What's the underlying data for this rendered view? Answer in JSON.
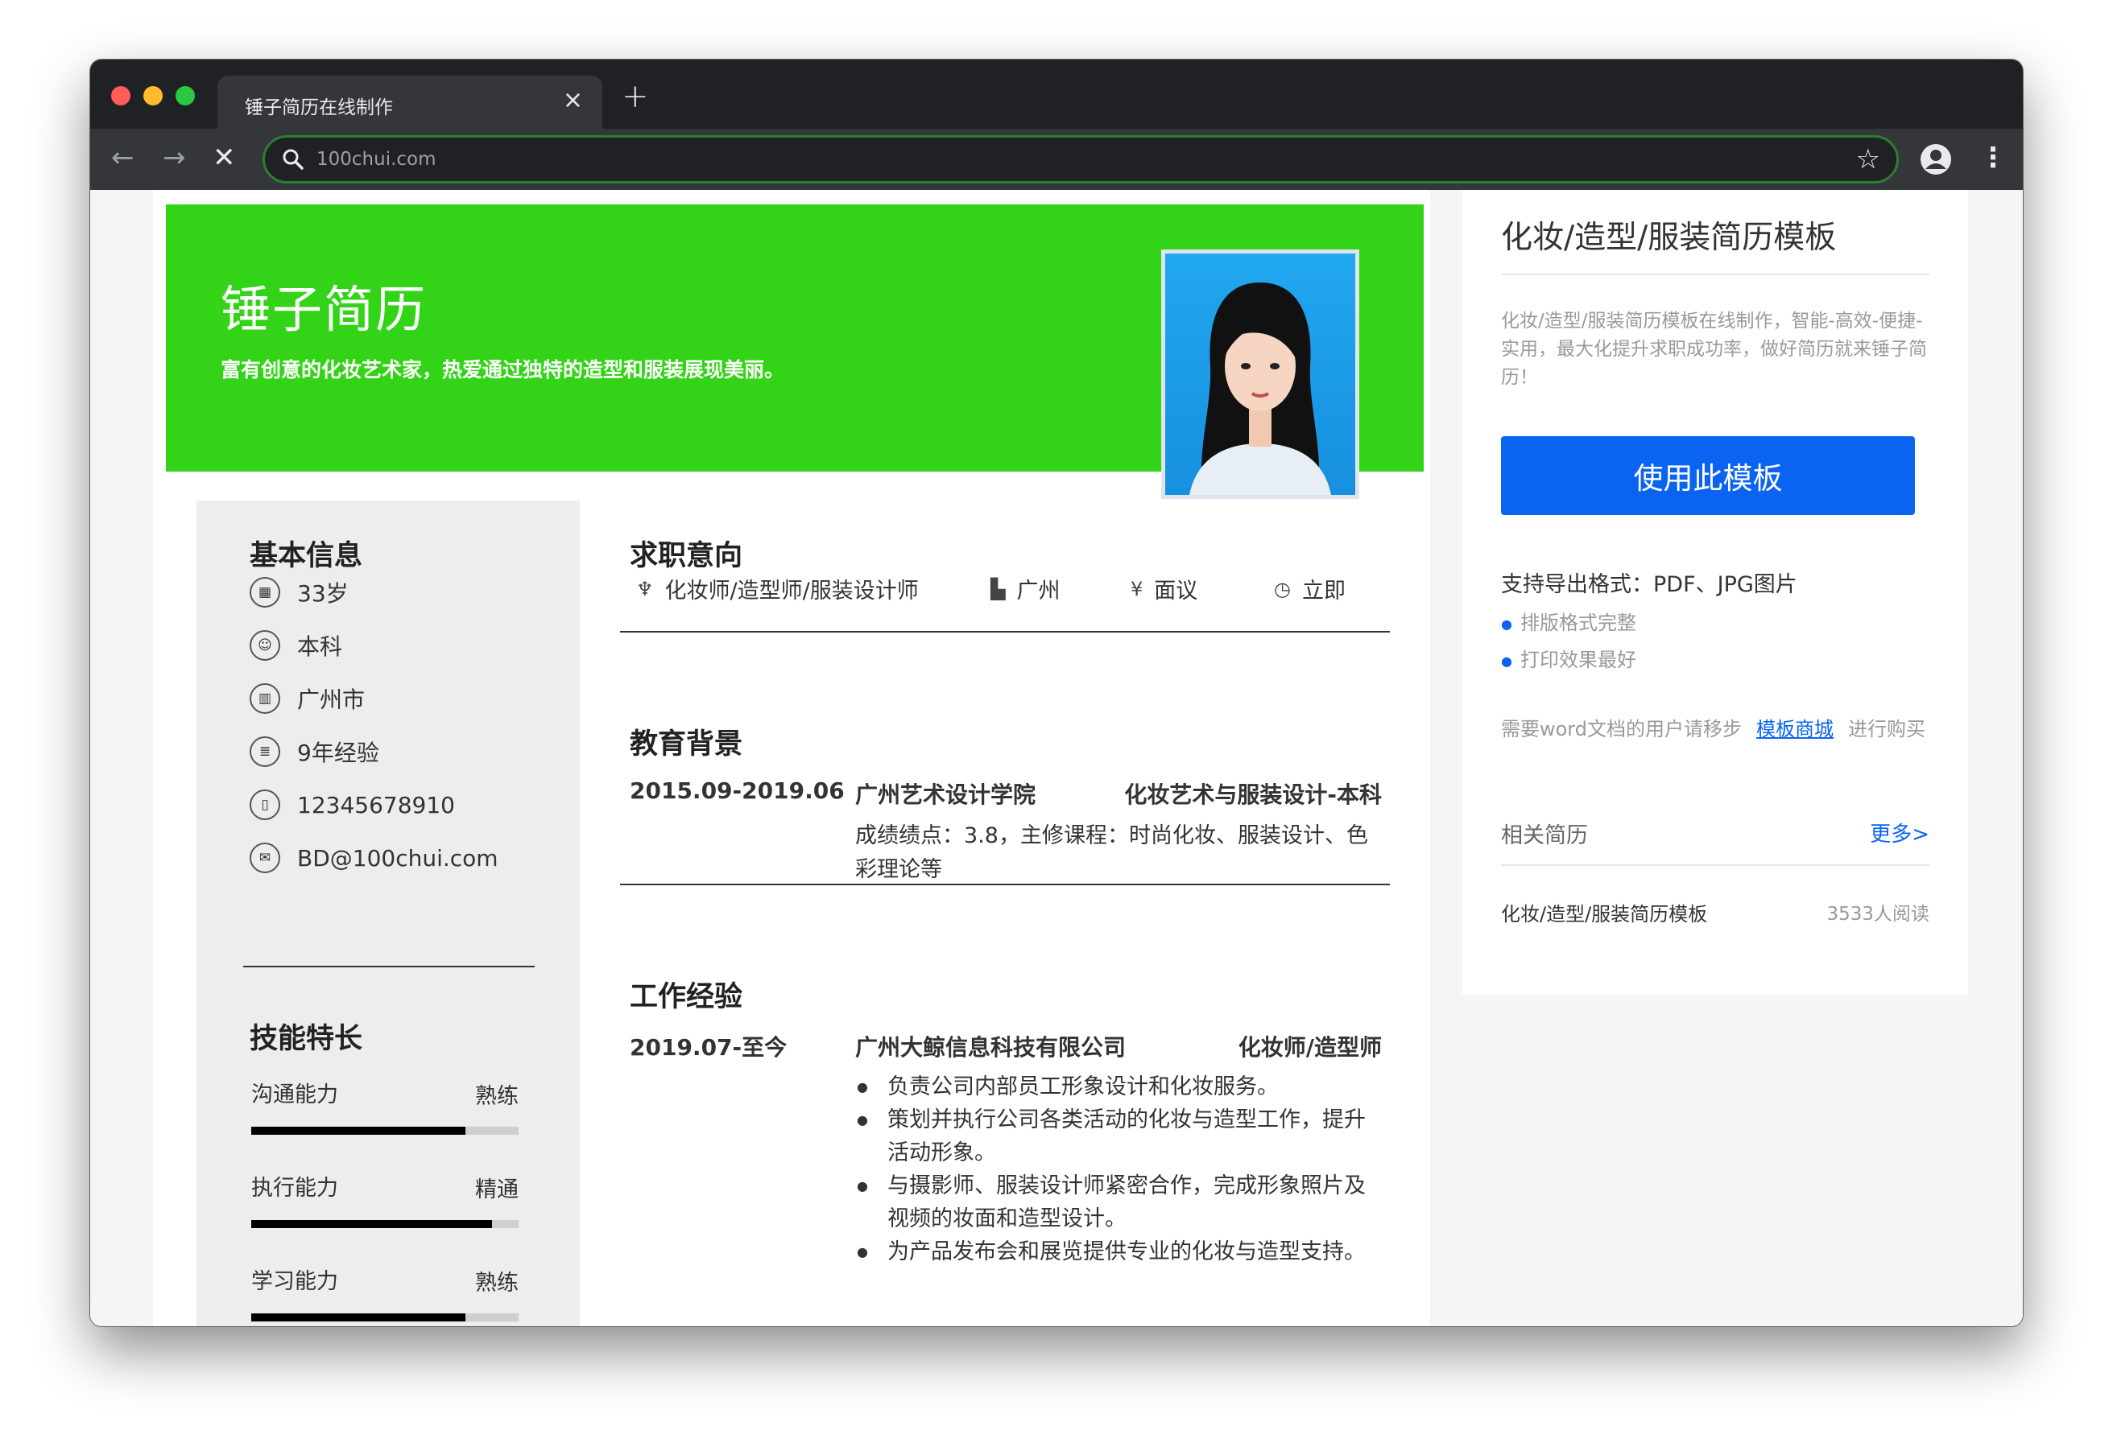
{
  "browser": {
    "tab_title": "锤子简历在线制作",
    "tab_close": "×",
    "new_tab": "+",
    "url": "100chui.com",
    "back": "←",
    "forward": "→",
    "stop": "✕",
    "star": "☆",
    "menu": "⋮",
    "accent_color": "#2f7d32"
  },
  "resume": {
    "banner_color": "#33d417",
    "name": "锤子简历",
    "slogan": "富有创意的化妆艺术家，热爱通过独特的造型和服装展现美丽。",
    "basic_info": {
      "title": "基本信息",
      "items": [
        {
          "icon": "calendar-icon",
          "glyph": "▦",
          "text": "33岁"
        },
        {
          "icon": "graduation-icon",
          "glyph": "☺",
          "text": "本科"
        },
        {
          "icon": "building-icon",
          "glyph": "▥",
          "text": "广州市"
        },
        {
          "icon": "list-icon",
          "glyph": "≣",
          "text": "9年经验"
        },
        {
          "icon": "phone-icon",
          "glyph": "▯",
          "text": "12345678910"
        },
        {
          "icon": "mail-icon",
          "glyph": "✉",
          "text": "BD@100chui.com"
        }
      ]
    },
    "skills": {
      "title": "技能特长",
      "items": [
        {
          "name": "沟通能力",
          "level": "熟练",
          "fill": 0.8
        },
        {
          "name": "执行能力",
          "level": "精通",
          "fill": 0.9
        },
        {
          "name": "学习能力",
          "level": "熟练",
          "fill": 0.8
        }
      ]
    },
    "intent": {
      "title": "求职意向",
      "position": {
        "icon": "tie-icon",
        "glyph": "♆",
        "text": "化妆师/造型师/服装设计师"
      },
      "city": {
        "icon": "city-icon",
        "glyph": "▙",
        "text": "广州"
      },
      "salary": {
        "icon": "yen-icon",
        "glyph": "¥",
        "text": "面议"
      },
      "availability": {
        "icon": "clock-icon",
        "glyph": "◷",
        "text": "立即"
      }
    },
    "education": {
      "title": "教育背景",
      "date": "2015.09-2019.06",
      "school": "广州艺术设计学院",
      "major": "化妆艺术与服装设计-本科",
      "desc": "成绩绩点：3.8，主修课程：时尚化妆、服装设计、色彩理论等"
    },
    "work": {
      "title": "工作经验",
      "date": "2019.07-至今",
      "company": "广州大鲸信息科技有限公司",
      "role": "化妆师/造型师",
      "bullets": [
        "负责公司内部员工形象设计和化妆服务。",
        "策划并执行公司各类活动的化妆与造型工作，提升活动形象。",
        "与摄影师、服装设计师紧密合作，完成形象照片及视频的妆面和造型设计。",
        "为产品发布会和展览提供专业的化妆与造型支持。"
      ]
    }
  },
  "sidebar": {
    "title": "化妆/造型/服装简历模板",
    "description": "化妆/造型/服装简历模板在线制作，智能-高效-便捷-实用，最大化提升求职成功率，做好简历就来锤子简历！",
    "use_button": "使用此模板",
    "button_color": "#0a64f1",
    "support_formats": "支持导出格式：PDF、JPG图片",
    "features": [
      "排版格式完整",
      "打印效果最好"
    ],
    "word_prefix": "需要word文档的用户请移步",
    "word_link": "模板商城",
    "word_suffix": "进行购买",
    "related_label": "相关简历",
    "more_link": "更多>",
    "related_item": "化妆/造型/服装简历模板",
    "related_reads": "3533人阅读"
  }
}
